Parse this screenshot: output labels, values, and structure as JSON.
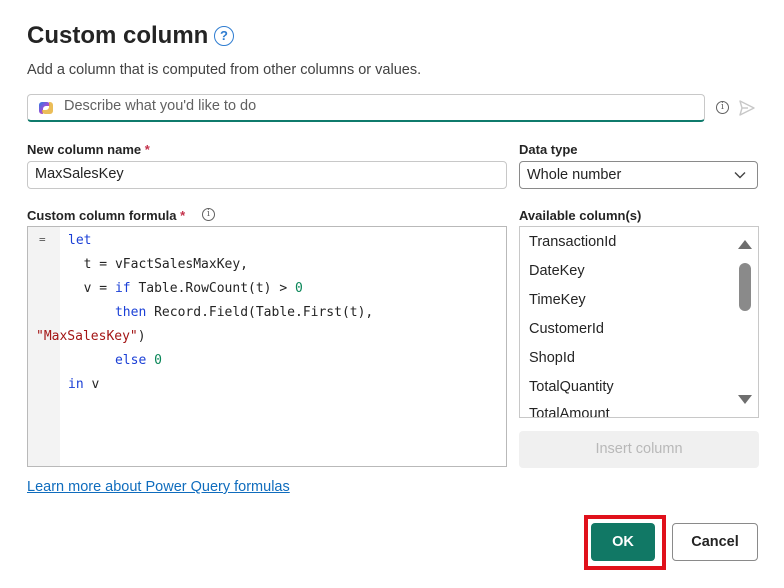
{
  "dialog": {
    "title": "Custom column",
    "subtitle": "Add a column that is computed from other columns or values."
  },
  "copilot": {
    "placeholder": "Describe what you'd like to do",
    "info_icon": "info-icon",
    "send_icon": "send-icon"
  },
  "new_column": {
    "label": "New column name",
    "required_mark": "*",
    "value": "MaxSalesKey"
  },
  "data_type": {
    "label": "Data type",
    "selected": "Whole number"
  },
  "formula": {
    "label": "Custom column formula",
    "required_mark": "*",
    "gutter_glyph": "=",
    "lines": {
      "l1_kw": "let",
      "l2_pre": "  t = vFactSalesMaxKey,",
      "l3_pre": "  v = ",
      "l3_kw": "if",
      "l3_mid": " Table.RowCount(t) > ",
      "l3_num": "0",
      "l4_indent": "      ",
      "l4_kw": "then",
      "l4_rest": " Record.Field(Table.First(t),",
      "l5_str": "\"MaxSalesKey\"",
      "l5_rest": ")",
      "l6_indent": "      ",
      "l6_kw": "else",
      "l6_num": " 0",
      "l7_kw": "in",
      "l7_rest": " v"
    }
  },
  "available_columns": {
    "label": "Available column(s)",
    "items": [
      "TransactionId",
      "DateKey",
      "TimeKey",
      "CustomerId",
      "ShopId",
      "TotalQuantity",
      "TotalAmount"
    ]
  },
  "insert_button": "Insert column",
  "learn_link": "Learn more about Power Query formulas",
  "ok_button": "OK",
  "cancel_button": "Cancel",
  "colors": {
    "accent": "#117865",
    "highlight": "#e0111b",
    "link": "#0f6cbd"
  }
}
